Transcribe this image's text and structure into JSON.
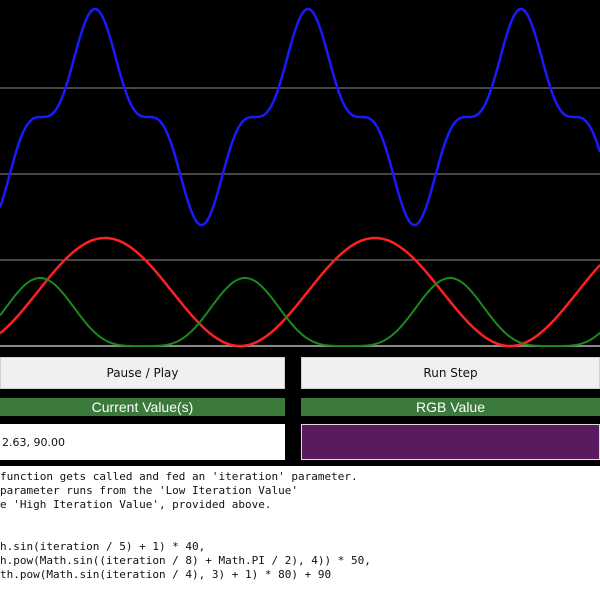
{
  "controls": {
    "pause_play_label": "Pause / Play",
    "run_step_label": "Run Step"
  },
  "panels": {
    "current_value_header": "Current Value(s)",
    "rgb_value_header": "RGB Value",
    "current_value_text": "2.63, 90.00",
    "rgb_swatch_color": "#5a1a60"
  },
  "code_lines": [
    "function gets called and fed an 'iteration' parameter.",
    "parameter runs from the 'Low Iteration Value'",
    "e 'High Iteration Value', provided above.",
    "",
    "",
    "h.sin(iteration / 5) + 1) * 40,",
    "h.pow(Math.sin((iteration / 8) + Math.PI / 2), 4)) * 50,",
    "th.pow(Math.sin(iteration / 4), 3) + 1) * 80) + 90"
  ],
  "colors": {
    "background": "#000000",
    "blue_series": "#1a1aff",
    "red_series": "#ff2020",
    "green_series": "#1a8a1a",
    "gridline": "#8a8a8a",
    "header_green": "#3c7a3c"
  }
}
